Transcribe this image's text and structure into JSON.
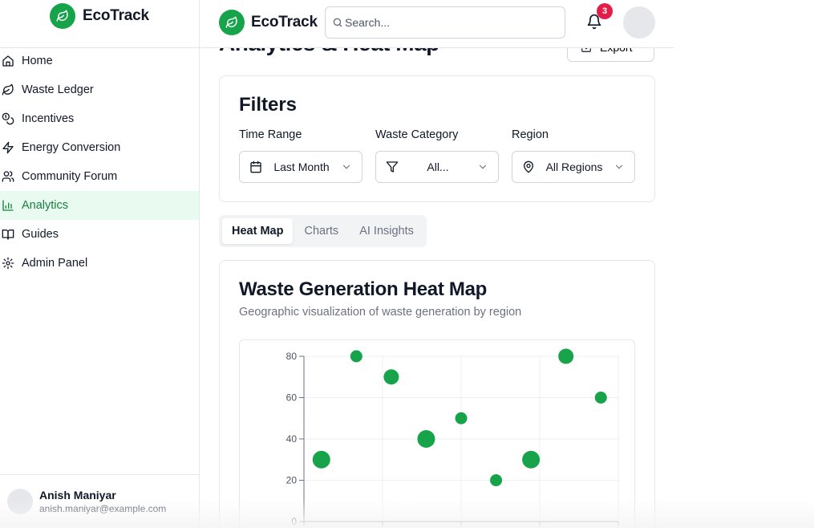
{
  "app": {
    "name": "EcoTrack"
  },
  "sidebar": {
    "items": [
      {
        "label": "Home",
        "icon": "home-icon",
        "active": false
      },
      {
        "label": "Waste Ledger",
        "icon": "leaf-icon",
        "active": false
      },
      {
        "label": "Incentives",
        "icon": "coins-icon",
        "active": false
      },
      {
        "label": "Energy Conversion",
        "icon": "zap-icon",
        "active": false
      },
      {
        "label": "Community Forum",
        "icon": "users-icon",
        "active": false
      },
      {
        "label": "Analytics",
        "icon": "bar-chart-icon",
        "active": true
      },
      {
        "label": "Guides",
        "icon": "book-icon",
        "active": false
      },
      {
        "label": "Admin Panel",
        "icon": "gear-icon",
        "active": false
      }
    ],
    "user": {
      "name": "Anish Maniyar",
      "email": "anish.maniyar@example.com"
    }
  },
  "header": {
    "search_placeholder": "Search...",
    "notification_count": "3"
  },
  "page": {
    "title": "Analytics & Heat Map",
    "export_label": "Export"
  },
  "filters": {
    "title": "Filters",
    "time_range": {
      "label": "Time Range",
      "value": "Last Month",
      "icon": "calendar-icon"
    },
    "waste_category": {
      "label": "Waste Category",
      "value": "All...",
      "icon": "filter-icon"
    },
    "region": {
      "label": "Region",
      "value": "All Regions",
      "icon": "map-pin-icon"
    }
  },
  "tabs": [
    {
      "label": "Heat Map",
      "active": true
    },
    {
      "label": "Charts",
      "active": false
    },
    {
      "label": "AI Insights",
      "active": false
    }
  ],
  "heatmap": {
    "title": "Waste Generation Heat Map",
    "subtitle": "Geographic visualization of waste generation by region"
  },
  "chart_data": {
    "type": "scatter",
    "ylim": [
      0,
      80
    ],
    "yticks": [
      "0",
      "20",
      "40",
      "60",
      "80"
    ],
    "points": [
      {
        "x": 1,
        "y": 30,
        "size": "large"
      },
      {
        "x": 2,
        "y": 80,
        "size": "small"
      },
      {
        "x": 3,
        "y": 70,
        "size": "medium"
      },
      {
        "x": 4,
        "y": 40,
        "size": "large"
      },
      {
        "x": 5,
        "y": 50,
        "size": "small"
      },
      {
        "x": 6,
        "y": 20,
        "size": "small"
      },
      {
        "x": 7,
        "y": 30,
        "size": "large"
      },
      {
        "x": 8,
        "y": 80,
        "size": "medium"
      },
      {
        "x": 9,
        "y": 60,
        "size": "small"
      }
    ],
    "grid": true,
    "point_color": "#16a34a"
  },
  "colors": {
    "accent": "#16a34a",
    "active_bg": "#e9fbf0",
    "badge": "#e11d48"
  }
}
